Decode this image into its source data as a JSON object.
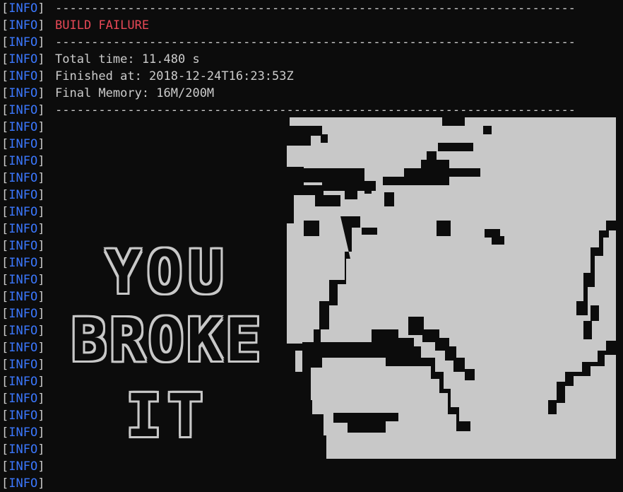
{
  "terminal": {
    "level": "INFO",
    "lines": [
      {
        "kind": "rule",
        "text": "------------------------------------------------------------------------"
      },
      {
        "kind": "error",
        "text": "BUILD FAILURE"
      },
      {
        "kind": "rule",
        "text": "------------------------------------------------------------------------"
      },
      {
        "kind": "text",
        "text": "Total time: 11.480 s"
      },
      {
        "kind": "text",
        "text": "Finished at: 2018-12-24T16:23:53Z"
      },
      {
        "kind": "text",
        "text": "Final Memory: 16M/200M"
      },
      {
        "kind": "rule",
        "text": "------------------------------------------------------------------------"
      },
      {
        "kind": "art",
        "text": ""
      },
      {
        "kind": "art",
        "text": ""
      },
      {
        "kind": "art",
        "text": ""
      },
      {
        "kind": "art",
        "text": ""
      },
      {
        "kind": "art",
        "text": ""
      },
      {
        "kind": "art",
        "text": ""
      },
      {
        "kind": "art",
        "text": ""
      },
      {
        "kind": "art",
        "text": ""
      },
      {
        "kind": "art",
        "text": ""
      },
      {
        "kind": "art",
        "text": ""
      },
      {
        "kind": "art",
        "text": ""
      },
      {
        "kind": "art",
        "text": ""
      },
      {
        "kind": "art",
        "text": ""
      },
      {
        "kind": "art",
        "text": ""
      },
      {
        "kind": "art",
        "text": ""
      },
      {
        "kind": "art",
        "text": ""
      },
      {
        "kind": "art",
        "text": ""
      },
      {
        "kind": "art",
        "text": ""
      },
      {
        "kind": "art",
        "text": ""
      },
      {
        "kind": "art",
        "text": ""
      },
      {
        "kind": "art",
        "text": ""
      },
      {
        "kind": "art",
        "text": ""
      }
    ]
  },
  "art": {
    "words": [
      "YOU",
      "BROKE",
      "IT"
    ],
    "image": "angry-face-pixel-art"
  },
  "colors": {
    "background": "#0c0c0c",
    "foreground": "#cccccc",
    "level": "#3b78ff",
    "error": "#e74856",
    "art_light": "#c8c8c8"
  }
}
